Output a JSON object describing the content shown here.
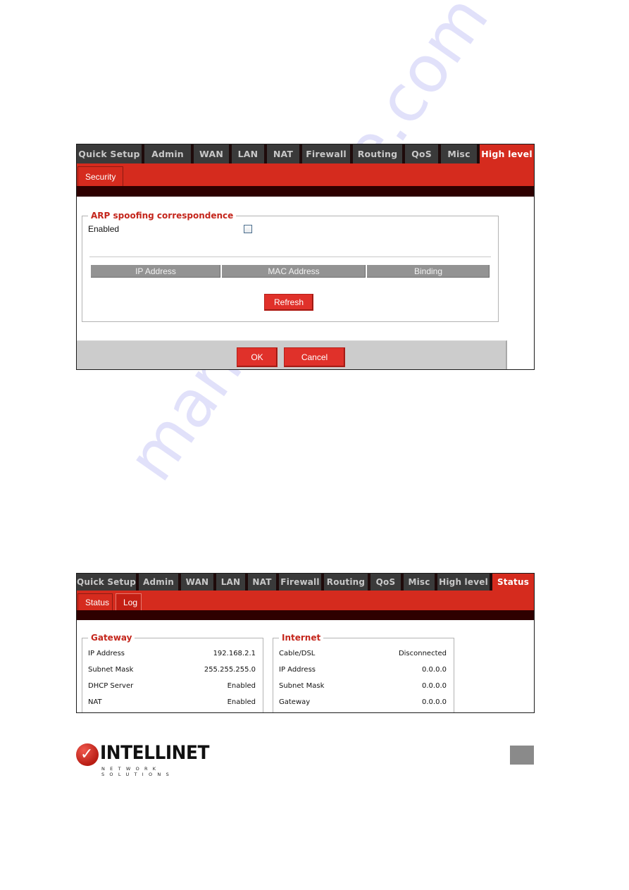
{
  "screenshot1": {
    "tabs": [
      {
        "label": "Quick Setup",
        "active": false
      },
      {
        "label": "Admin",
        "active": false
      },
      {
        "label": "WAN",
        "active": false
      },
      {
        "label": "LAN",
        "active": false
      },
      {
        "label": "NAT",
        "active": false
      },
      {
        "label": "Firewall",
        "active": false
      },
      {
        "label": "Routing",
        "active": false
      },
      {
        "label": "QoS",
        "active": false
      },
      {
        "label": "Misc",
        "active": false
      },
      {
        "label": "High level",
        "active": true
      }
    ],
    "subtabs": [
      {
        "label": "Security",
        "active": true
      }
    ],
    "section_title": "ARP spoofing correspondence",
    "enabled_label": "Enabled",
    "enabled_checked": false,
    "table_headers": [
      "IP Address",
      "MAC Address",
      "Binding"
    ],
    "refresh_label": "Refresh",
    "ok_label": "OK",
    "cancel_label": "Cancel"
  },
  "screenshot2": {
    "tabs": [
      {
        "label": "Quick Setup",
        "active": false
      },
      {
        "label": "Admin",
        "active": false
      },
      {
        "label": "WAN",
        "active": false
      },
      {
        "label": "LAN",
        "active": false
      },
      {
        "label": "NAT",
        "active": false
      },
      {
        "label": "Firewall",
        "active": false
      },
      {
        "label": "Routing",
        "active": false
      },
      {
        "label": "QoS",
        "active": false
      },
      {
        "label": "Misc",
        "active": false
      },
      {
        "label": "High level",
        "active": false
      },
      {
        "label": "Status",
        "active": true
      }
    ],
    "subtabs": [
      {
        "label": "Status",
        "active": true
      },
      {
        "label": "Log",
        "active": false
      }
    ],
    "gateway": {
      "title": "Gateway",
      "rows": [
        {
          "label": "IP Address",
          "value": "192.168.2.1"
        },
        {
          "label": "Subnet Mask",
          "value": "255.255.255.0"
        },
        {
          "label": "DHCP Server",
          "value": "Enabled"
        },
        {
          "label": "NAT",
          "value": "Enabled"
        }
      ]
    },
    "internet": {
      "title": "Internet",
      "rows": [
        {
          "label": "Cable/DSL",
          "value": "Disconnected"
        },
        {
          "label": "IP Address",
          "value": "0.0.0.0"
        },
        {
          "label": "Subnet Mask",
          "value": "0.0.0.0"
        },
        {
          "label": "Gateway",
          "value": "0.0.0.0"
        }
      ]
    }
  },
  "footer": {
    "brand": "INTELLINET",
    "tagline": "NETWORK SOLUTIONS",
    "page_number": ""
  },
  "watermark": "manualshive.com",
  "colors": {
    "accent_red": "#d52b1e",
    "tab_dark": "#3a3a3a",
    "dark_bar": "#2e0000",
    "legend_red": "#c4261c"
  }
}
